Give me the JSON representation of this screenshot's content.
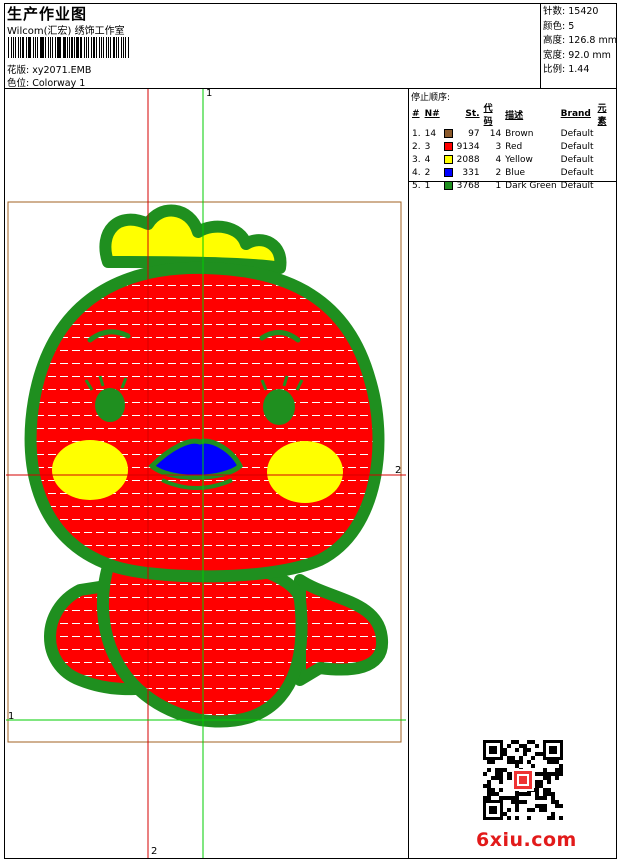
{
  "header": {
    "title": "生产作业图",
    "subtitle": "Wilcom(汇宏) 绣饰工作室",
    "design_label": "花版:",
    "design_file": "xy2071.EMB",
    "colorway_label": "色位:",
    "colorway": "Colorway 1"
  },
  "stats": {
    "stitches_label": "针数:",
    "stitches": "15420",
    "colors_label": "颜色:",
    "colors": "5",
    "height_label": "高度:",
    "height": "126.8 mm",
    "width_label": "宽度:",
    "width": "92.0 mm",
    "ratio_label": "比例:",
    "ratio": "1.44"
  },
  "sequence": {
    "label": "停止顺序:",
    "headers": [
      "#",
      "N#",
      "St.",
      "代码",
      "描述",
      "Brand",
      "元素"
    ],
    "rows": [
      {
        "idx": "1.",
        "n": "14",
        "color": "#8b5a2b",
        "st": "97",
        "code": "14",
        "desc": "Brown",
        "brand": "Default"
      },
      {
        "idx": "2.",
        "n": "3",
        "color": "#ff0000",
        "st": "9134",
        "code": "3",
        "desc": "Red",
        "brand": "Default"
      },
      {
        "idx": "3.",
        "n": "4",
        "color": "#ffff00",
        "st": "2088",
        "code": "4",
        "desc": "Yellow",
        "brand": "Default"
      },
      {
        "idx": "4.",
        "n": "2",
        "color": "#0000ff",
        "st": "331",
        "code": "2",
        "desc": "Blue",
        "brand": "Default"
      },
      {
        "idx": "5.",
        "n": "1",
        "color": "#1f8f1f",
        "st": "3768",
        "code": "1",
        "desc": "Dark Green",
        "brand": "Default"
      }
    ]
  },
  "guides": {
    "v1": "1",
    "v2": "2",
    "h1": "1",
    "h2": "2"
  },
  "watermark": "6xiu.com",
  "colors": {
    "red": "#ff0000",
    "green": "#1f8f1f",
    "yellow": "#ffff00",
    "blue": "#0000ff",
    "brown_box": "#8b5a2b",
    "guide_red": "#d40000",
    "guide_green": "#00cc00"
  }
}
